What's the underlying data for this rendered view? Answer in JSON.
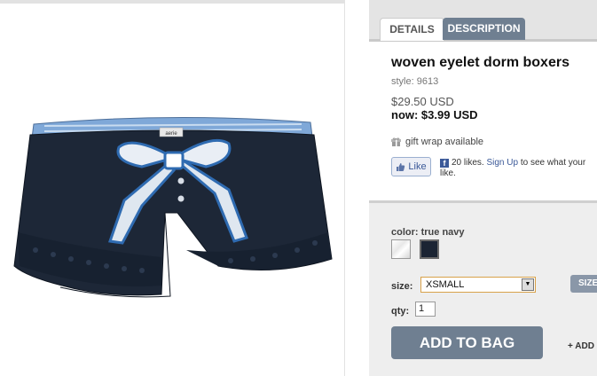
{
  "tabs": [
    {
      "label": "DETAILS"
    },
    {
      "label": "DESCRIPTION"
    }
  ],
  "product": {
    "title": "woven eyelet dorm boxers",
    "style": "style: 9613",
    "price_old": "$29.50 USD",
    "price_now": "now: $3.99 USD",
    "image_label": "aerie"
  },
  "gift_wrap": "gift wrap available",
  "facebook": {
    "like_label": "Like",
    "likes_text": "20 likes.",
    "signup_link": "Sign Up",
    "rest_text": " to see what your",
    "rest_text_2": "like."
  },
  "options": {
    "color_label": "color: true navy",
    "size_label": "size:",
    "size_value": "XSMALL",
    "size_chart_label": "SIZE",
    "qty_label": "qty:",
    "qty_value": "1"
  },
  "actions": {
    "add_to_bag": "ADD TO BAG",
    "add_link": "+ ADD"
  },
  "colors": {
    "accent": "#6f7f91",
    "navy": "#1b2433",
    "facebook": "#3b5998"
  }
}
